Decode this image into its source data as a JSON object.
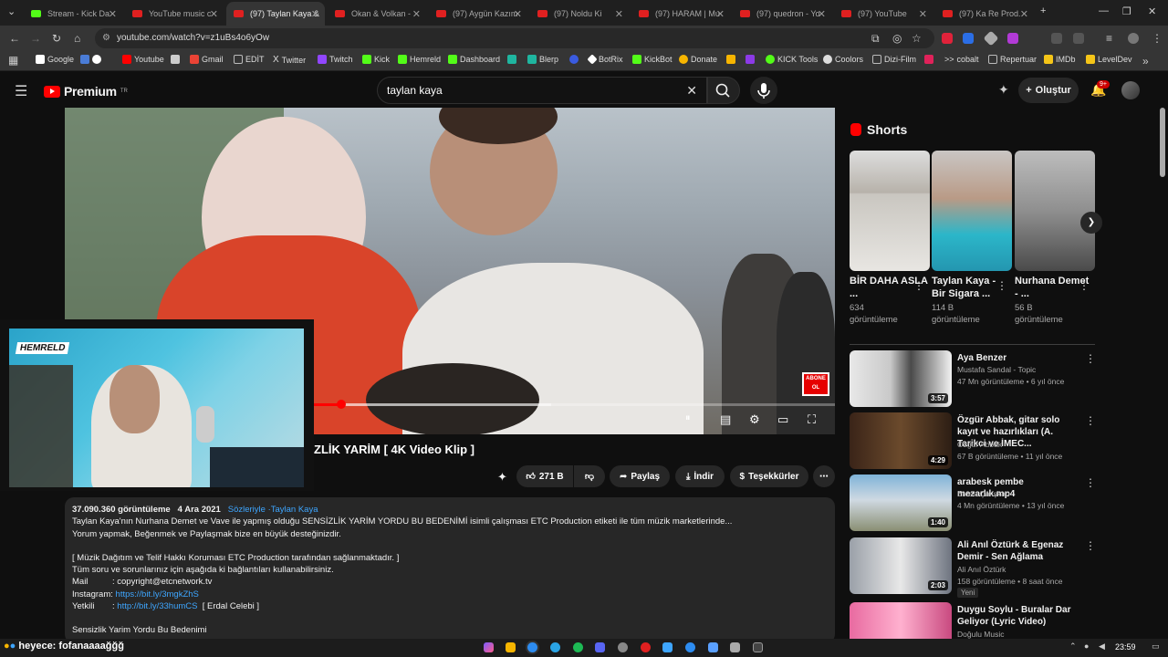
{
  "browser": {
    "tabs": [
      {
        "title": "Stream - Kick Da",
        "kind": "kick"
      },
      {
        "title": "YouTube music c",
        "kind": "yt"
      },
      {
        "title": "(97) Taylan Kaya &",
        "kind": "yt",
        "active": true
      },
      {
        "title": "Okan & Volkan -",
        "kind": "yt"
      },
      {
        "title": "(97) Aygün Kazım",
        "kind": "yt"
      },
      {
        "title": "(97) Noldu Ki ",
        "kind": "yt"
      },
      {
        "title": "(97) HARAM | Mu",
        "kind": "yt"
      },
      {
        "title": "(97) quedron - Yo",
        "kind": "yt"
      },
      {
        "title": "(97) YouTube",
        "kind": "yt"
      },
      {
        "title": "(97) Ka Re Prod.",
        "kind": "yt"
      }
    ],
    "url": "youtube.com/watch?v=z1uBs4o6yOw",
    "bookmarks": [
      "Google",
      "Youtube",
      "Gmail",
      "EDİT",
      "Twitter",
      "Twitch",
      "Kick",
      "Hemreld",
      "Dashboard",
      "Blerp",
      "BotRix",
      "KickBot",
      "Donate",
      "KICK Tools",
      "Coolors",
      "Dizi-Film",
      "cobalt",
      "Repertuar",
      "IMDb",
      "LevelDev"
    ]
  },
  "youtube": {
    "logo": "Premium",
    "logo_sup": "TR",
    "search_value": "taylan kaya",
    "create_label": "Oluştur",
    "notif_count": "9+",
    "video_title": "ZLİK YARİM [ 4K Video Klip ]",
    "abone_text": "ABONE OL",
    "actions": {
      "likes": "271 B",
      "share": "Paylaş",
      "download": "İndir",
      "thanks": "Teşekkürler"
    },
    "description": {
      "views": "37.090.360 görüntüleme",
      "date": "4 Ara 2021",
      "tags": "Sözleriyle ·Taylan Kaya",
      "line1": "Taylan Kaya'nın Nurhana Demet ve Vave ile yapmış olduğu SENSİZLİK YARİM YORDU BU BEDENİMİ isimli çalışması ETC Production etiketi ile tüm müzik marketlerinde...",
      "line2": "Yorum yapmak, Beğenmek ve Paylaşmak bize en büyük desteğinizdir.",
      "line3": "[ Müzik Dağıtım ve Telif Hakkı Koruması ETC Production tarafından sağlanmaktadır. ]",
      "line4": "Tüm soru ve sorunlarınız için aşağıda ki bağlantıları kullanabilirsiniz.",
      "mail_label": "Mail",
      "mail_value": ": copyright@etcnetwork.tv",
      "ig_label": "Instagram:",
      "ig_link": "https://bit.ly/3mgkZhS",
      "yetkili_label": "Yetkili",
      "yetkili_link": "http://bit.ly/33humCS",
      "yetkili_name": "[ Erdal Celebi ]",
      "last": "Sensizlik Yarim Yordu Bu Bedenimi"
    },
    "shorts_title": "Shorts",
    "shorts": [
      {
        "title": "BİR DAHA ASLA ...",
        "views": "634",
        "views2": "görüntüleme"
      },
      {
        "title": "Taylan Kaya - Bir Sigara ...",
        "views": "114 B",
        "views2": "görüntüleme"
      },
      {
        "title": "Nurhana Demet - ...",
        "views": "56 B",
        "views2": "görüntüleme"
      }
    ],
    "recommended": [
      {
        "title": "Aya Benzer",
        "channel": "Mustafa Sandal - Topic",
        "meta": "47 Mn görüntüleme • 6 yıl önce",
        "duration": "3:57"
      },
      {
        "title": "Özgür Abbak, gitar solo kayıt ve hazırlıkları (A. Tarikci ve İMEC...",
        "channel": "Özgür Abbak",
        "meta": "67 B görüntüleme • 11 yıl önce",
        "duration": "4:29"
      },
      {
        "title": "arabesk pembe mezarlık.mp4",
        "channel": "Ercan Çalışkan",
        "meta": "4 Mn görüntüleme • 13 yıl önce",
        "duration": "1:40"
      },
      {
        "title": "Ali Anıl Öztürk & Egenaz Demir - Sen Ağlama",
        "channel": "Ali Anıl Öztürk",
        "meta": "158 görüntüleme • 8 saat önce",
        "duration": "2:03",
        "badge": "Yeni"
      },
      {
        "title": "Duygu Soylu - Buralar Dar Geliyor (Lyric Video)",
        "channel": "Doğulu Music",
        "meta": "",
        "duration": ""
      }
    ]
  },
  "stream": {
    "cam_logo": "HEMRELD",
    "chat_line": "heyece: fofanaaaağğğ"
  },
  "taskbar": {
    "clock": "23:59"
  },
  "colors": {
    "accent_red": "#ff0000",
    "link_blue": "#3ea6ff",
    "kick_green": "#53fc18"
  }
}
